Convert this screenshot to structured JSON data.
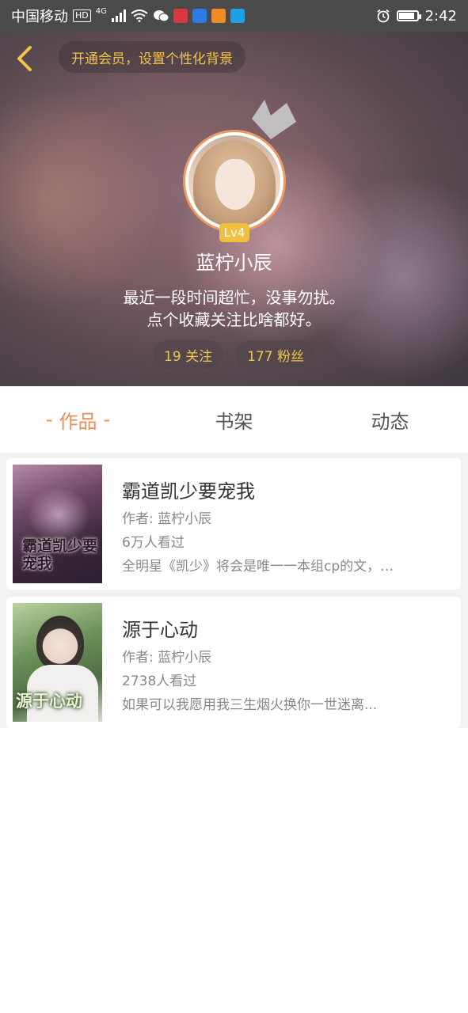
{
  "status_bar": {
    "carrier": "中国移动",
    "hd": "HD",
    "network": "4G",
    "time": "2:42",
    "icons": [
      "signal-icon",
      "wifi-icon",
      "wechat-icon",
      "app-red-icon",
      "app-blue-icon",
      "app-orange-icon",
      "app-cyan-icon",
      "alarm-icon",
      "battery-icon"
    ]
  },
  "header": {
    "vip_prompt": "开通会员，设置个性化背景",
    "level": "Lv4",
    "username": "蓝柠小辰",
    "bio_line1": "最近一段时间超忙，没事勿扰。",
    "bio_line2": "点个收藏关注比啥都好。",
    "following": "19 关注",
    "followers": "177 粉丝",
    "accent_color": "#f2c546"
  },
  "tabs": [
    {
      "label": "作品",
      "active": true
    },
    {
      "label": "书架",
      "active": false
    },
    {
      "label": "动态",
      "active": false
    }
  ],
  "tab_active_decor": "-",
  "books": [
    {
      "title": "霸道凯少要宠我",
      "author": "作者: 蓝柠小辰",
      "views": "6万人看过",
      "desc": "全明星《凯少》将会是唯一一本组cp的文，…",
      "cover_text": "霸道凯少要宠我"
    },
    {
      "title": "源于心动",
      "author": "作者: 蓝柠小辰",
      "views": "2738人看过",
      "desc": "如果可以我愿用我三生烟火换你一世迷离...",
      "cover_text": "源于心动"
    }
  ]
}
